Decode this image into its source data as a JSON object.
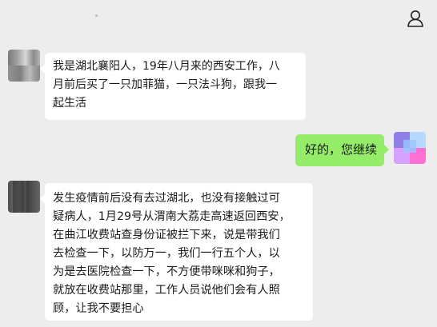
{
  "header": {
    "profile_icon": "person-icon"
  },
  "messages": [
    {
      "sender": "other",
      "lines": [
        "我是湖北襄阳人，19年八月来的西安工作，八",
        "月前后买了一只加菲猫，一只法斗狗，跟我一",
        "起生活"
      ]
    },
    {
      "sender": "self",
      "lines": [
        "好的，您继续"
      ]
    },
    {
      "sender": "other",
      "lines": [
        "发生疫情前后没有去过湖北，也没有接触过可",
        "疑病人，1月29号从渭南大荔走高速返回西安，",
        "在曲江收费站查身份证被拦下来，说是带我们",
        "去检查一下，以防万一，我们一行五个人，以",
        "为是去医院检查一下，不方便带咪咪和狗子，",
        "就放在收费站那里，工作人员说他们会有人照",
        "顾，让我不要担心"
      ]
    }
  ],
  "colors": {
    "background": "#ededed",
    "incoming_bubble": "#ffffff",
    "outgoing_bubble": "#95ec69",
    "text": "#1b1b1b"
  }
}
